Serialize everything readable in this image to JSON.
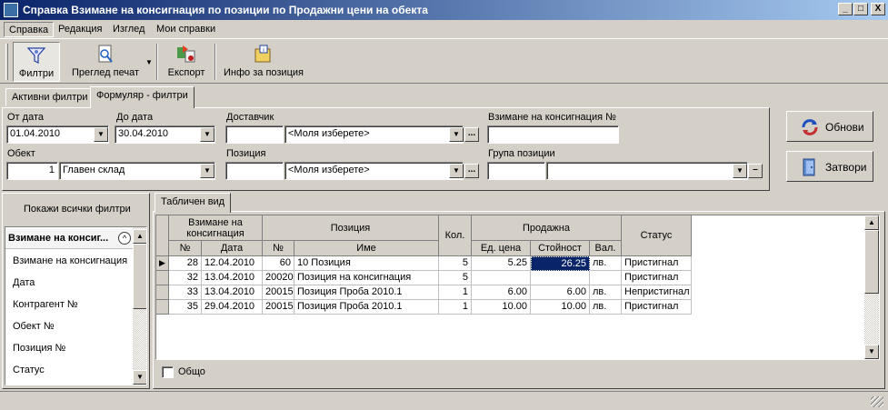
{
  "window": {
    "title": "Справка Взимане на консигнация по позиции по Продажни цени на обекта",
    "minimize": "_",
    "maximize": "□",
    "close": "X"
  },
  "menu": [
    "Справка",
    "Редакция",
    "Изглед",
    "Мои справки"
  ],
  "toolbar": {
    "filters": "Филтри",
    "print_preview": "Преглед печат",
    "export": "Експорт",
    "item_info": "Инфо за позиция"
  },
  "filter_tabs": [
    "Активни филтри",
    "Формуляр - филтри"
  ],
  "form": {
    "from_date_label": "От дата",
    "from_date": "01.04.2010",
    "to_date_label": "До дата",
    "to_date": "30.04.2010",
    "supplier_label": "Доставчик",
    "supplier_code": "",
    "supplier_value": "<Моля изберете>",
    "consignment_no_label": "Взимане на консигнация №",
    "consignment_no": "",
    "object_label": "Обект",
    "object_code": "1",
    "object_value": "Главен склад",
    "item_label": "Позиция",
    "item_code": "",
    "item_value": "<Моля изберете>",
    "item_group_label": "Група позиции",
    "item_group_code": "",
    "item_group_value": "",
    "ellipsis": "...",
    "minus": "–"
  },
  "actions": {
    "refresh": "Обнови",
    "close": "Затвори"
  },
  "left_panel": {
    "show_all": "Покажи всички филтри",
    "list_header": "Взимане на консиг...",
    "items": [
      "Взимане на консигнация",
      "Дата",
      "Контрагент №",
      "Обект №",
      "Позиция №",
      "Статус"
    ]
  },
  "grid_tab": "Табличен вид",
  "grid": {
    "headers": {
      "consignment": "Взимане на консигнация",
      "item": "Позиция",
      "qty": "Кол.",
      "sale": "Продажна",
      "status": "Статус",
      "no": "№",
      "date": "Дата",
      "item_no": "№",
      "name": "Име",
      "unit_price": "Ед. цена",
      "value": "Стойност",
      "currency": "Вал."
    },
    "rows": [
      {
        "no": "28",
        "date": "12.04.2010",
        "item_no": "60",
        "name": "10 Позиция",
        "qty": "5",
        "unit_price": "5.25",
        "value": "26.25",
        "currency": "лв.",
        "status": "Пристигнал"
      },
      {
        "no": "32",
        "date": "13.04.2010",
        "item_no": "20020",
        "name": "Позиция на консигнация",
        "qty": "5",
        "unit_price": "",
        "value": "",
        "currency": "",
        "status": "Пристигнал"
      },
      {
        "no": "33",
        "date": "13.04.2010",
        "item_no": "20015",
        "name": "Позиция Проба 2010.1",
        "qty": "1",
        "unit_price": "6.00",
        "value": "6.00",
        "currency": "лв.",
        "status": "Непристигнал"
      },
      {
        "no": "35",
        "date": "29.04.2010",
        "item_no": "20015",
        "name": "Позиция Проба 2010.1",
        "qty": "1",
        "unit_price": "10.00",
        "value": "10.00",
        "currency": "лв.",
        "status": "Пристигнал"
      }
    ]
  },
  "total_label": "Общо"
}
